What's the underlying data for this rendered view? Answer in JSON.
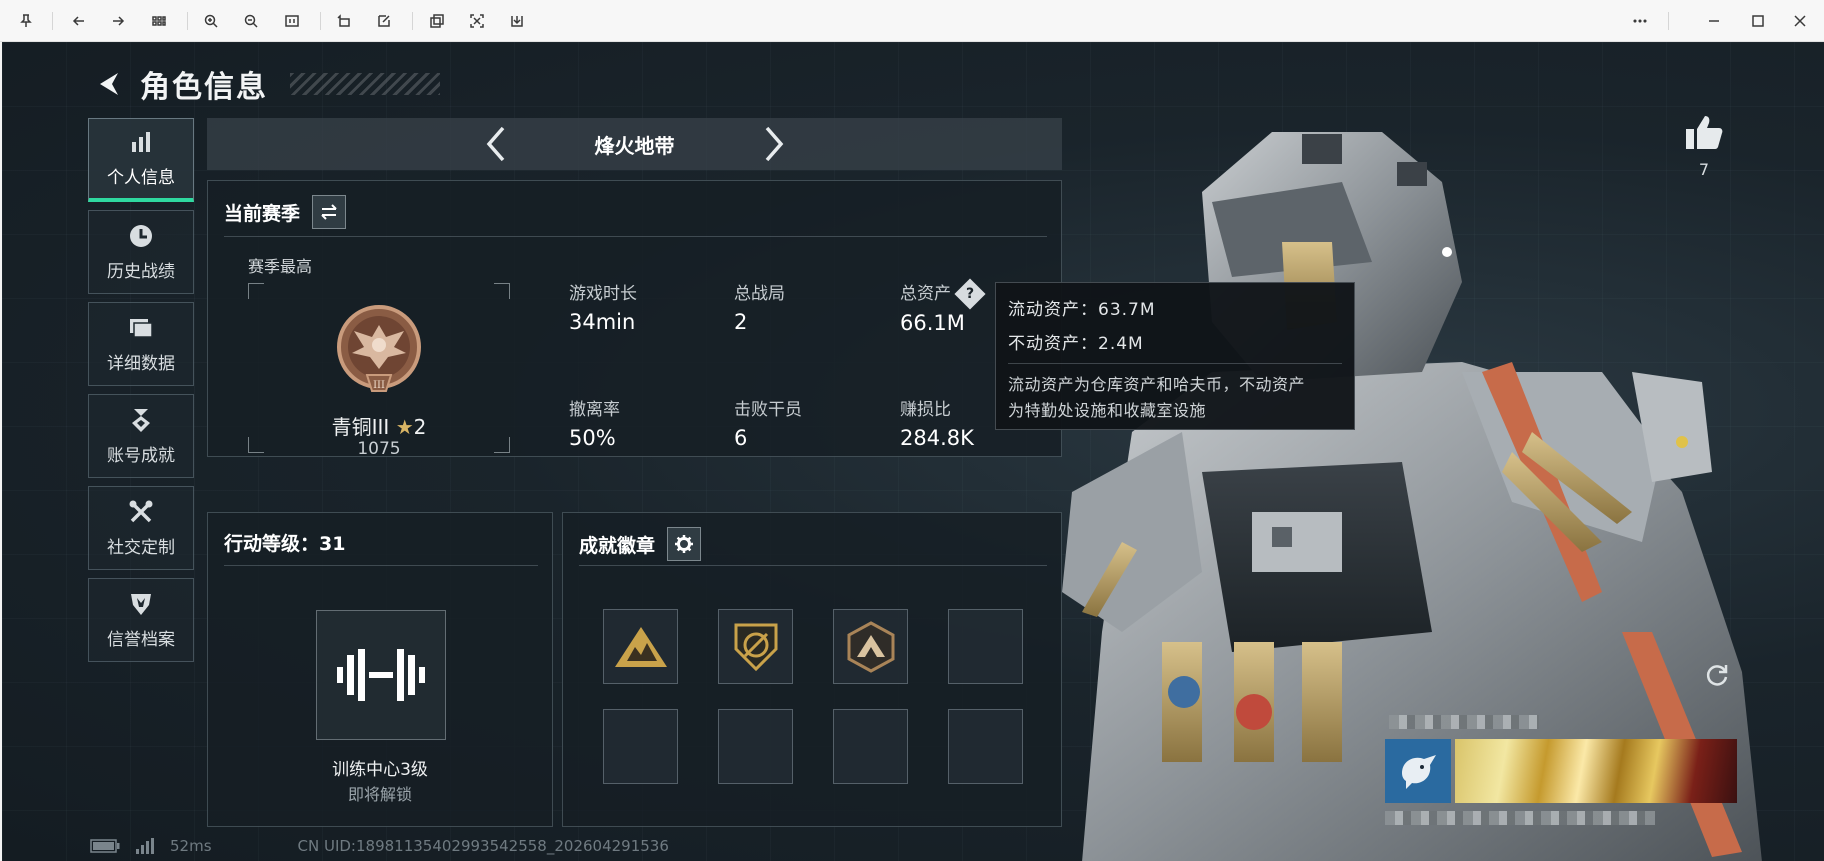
{
  "toolbar": {
    "icons": [
      "pin-icon",
      "back-icon",
      "forward-icon",
      "grid-icon",
      "zoom-in-icon",
      "zoom-out-icon",
      "actual-size-icon",
      "rotate-icon",
      "edit-icon",
      "copy-icon",
      "crop-icon",
      "save-icon",
      "more-icon",
      "minimize-icon",
      "maximize-icon",
      "close-icon"
    ]
  },
  "header": {
    "title": "角色信息"
  },
  "nav": [
    {
      "label": "个人信息",
      "icon": "bar-chart-icon",
      "active": true
    },
    {
      "label": "历史战绩",
      "icon": "clock-icon"
    },
    {
      "label": "详细数据",
      "icon": "folder-icon"
    },
    {
      "label": "账号成就",
      "icon": "medal-icon"
    },
    {
      "label": "社交定制",
      "icon": "tools-icon"
    },
    {
      "label": "信誉档案",
      "icon": "shield-icon"
    }
  ],
  "mode": {
    "title": "烽火地带"
  },
  "season": {
    "title": "当前赛季",
    "best_label": "赛季最高",
    "rank_name": "青铜III",
    "rank_stars": "2",
    "rank_score": "1075",
    "stats": [
      {
        "label": "游戏时长",
        "value": "34min"
      },
      {
        "label": "总战局",
        "value": "2"
      },
      {
        "label": "总资产",
        "value": "66.1M",
        "help": true
      },
      {
        "label": "撤离率",
        "value": "50%"
      },
      {
        "label": "击败干员",
        "value": "6"
      },
      {
        "label": "赚损比",
        "value": "284.8K"
      }
    ]
  },
  "tooltip": {
    "liquid": "流动资产：63.7M",
    "fixed": "不动资产：2.4M",
    "note_line1": "流动资产为仓库资产和哈夫币，不动资产",
    "note_line2": "为特勤处设施和收藏室设施"
  },
  "level": {
    "title": "行动等级：31",
    "name": "训练中心3级",
    "status": "即将解锁"
  },
  "badges": {
    "title": "成就徽章",
    "filled": [
      "triangle-camp-badge",
      "shield-cross-badge",
      "mountain-badge"
    ],
    "colors": {
      "gold": "#c9a24a",
      "bronze": "#a98458"
    }
  },
  "like": {
    "count": "7"
  },
  "footer": {
    "ping": "52ms",
    "uid": "CN UID:18981135402993542558_202604291536"
  },
  "colors": {
    "accent": "#2fd9a0",
    "bg": "#1a242b"
  }
}
